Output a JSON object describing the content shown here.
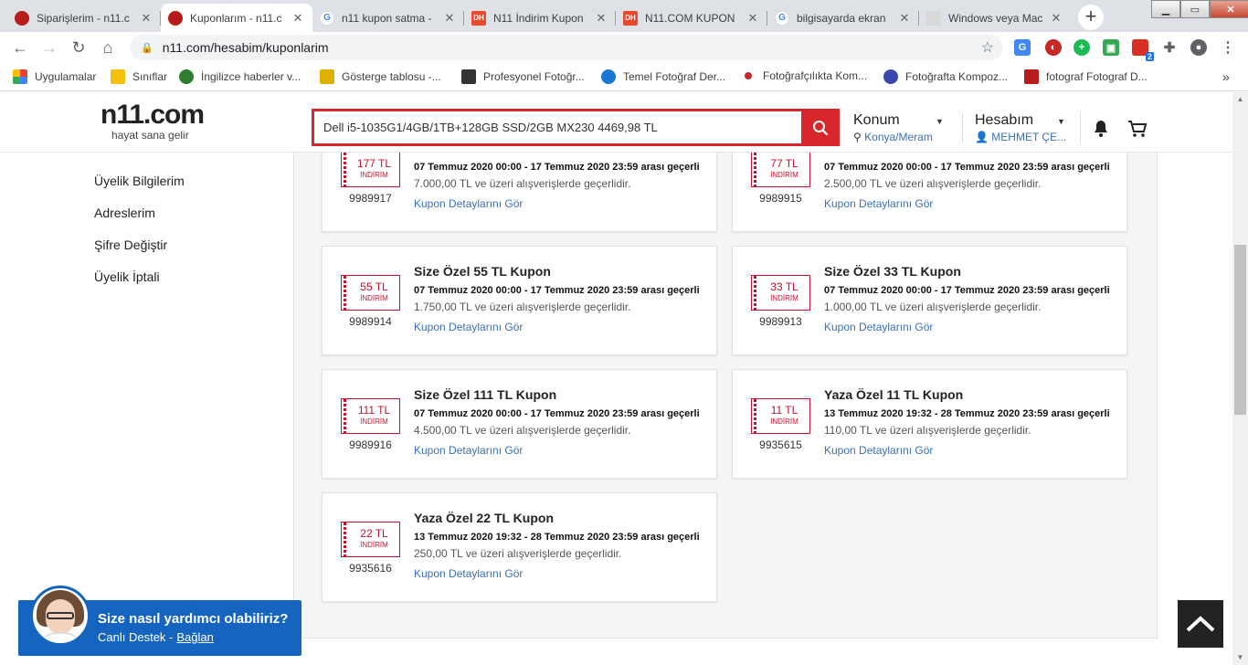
{
  "browser": {
    "tabs": [
      {
        "title": "Siparişlerim - n11.c",
        "icon": "ladybug-icon"
      },
      {
        "title": "Kuponlarım - n11.c",
        "icon": "ladybug-icon"
      },
      {
        "title": "n11 kupon satma -",
        "icon": "google-icon"
      },
      {
        "title": "N11 İndirim Kupon",
        "icon": "dh-icon"
      },
      {
        "title": "N11.COM KUPON",
        "icon": "dh-icon"
      },
      {
        "title": "bilgisayarda ekran",
        "icon": "google-icon"
      },
      {
        "title": "Windows veya Mac",
        "icon": "windows-icon"
      }
    ],
    "active_tab": 1,
    "url": "n11.com/hesabim/kuponlarim",
    "extension_badge": "2",
    "bookmarks": [
      "Uygulamalar",
      "Sınıflar",
      "İngilizce haberler v...",
      "Gösterge tablosu -...",
      "Profesyonel Fotoğr...",
      "Temel Fotoğraf Der...",
      "Fotoğrafçılıkta Kom...",
      "Fotoğrafta Kompoz...",
      "fotograf Fotograf D..."
    ],
    "bookmarks_overflow": "»"
  },
  "site": {
    "logo_text": "n11.com",
    "slogan": "hayat sana gelir",
    "search_value": "Dell i5-1035G1/4GB/1TB+128GB SSD/2GB MX230 4469,98 TL",
    "location_title": "Konum",
    "location_value": "Konya/Meram",
    "account_title": "Hesabım",
    "account_user": "MEHMET ÇE..."
  },
  "sidebar": {
    "items": [
      "Üyelik Bilgilerim",
      "Adreslerim",
      "Şifre Değiştir",
      "Üyelik İptali"
    ]
  },
  "coupons": [
    {
      "amount": "177 TL",
      "label": "İNDİRİM",
      "code": "9989917",
      "title": "",
      "date": "07 Temmuz 2020 00:00 - 17 Temmuz 2020 23:59 arası geçerli",
      "min": "7.000,00 TL ve üzeri alışverişlerde geçerlidir.",
      "link": "Kupon Detaylarını Gör"
    },
    {
      "amount": "77 TL",
      "label": "İNDİRİM",
      "code": "9989915",
      "title": "",
      "date": "07 Temmuz 2020 00:00 - 17 Temmuz 2020 23:59 arası geçerli",
      "min": "2.500,00 TL ve üzeri alışverişlerde geçerlidir.",
      "link": "Kupon Detaylarını Gör"
    },
    {
      "amount": "55 TL",
      "label": "İNDİRİM",
      "code": "9989914",
      "title": "Size Özel 55 TL Kupon",
      "date": "07 Temmuz 2020 00:00 - 17 Temmuz 2020 23:59 arası geçerli",
      "min": "1.750,00 TL ve üzeri alışverişlerde geçerlidir.",
      "link": "Kupon Detaylarını Gör"
    },
    {
      "amount": "33 TL",
      "label": "İNDİRİM",
      "code": "9989913",
      "title": "Size Özel 33 TL Kupon",
      "date": "07 Temmuz 2020 00:00 - 17 Temmuz 2020 23:59 arası geçerli",
      "min": "1.000,00 TL ve üzeri alışverişlerde geçerlidir.",
      "link": "Kupon Detaylarını Gör"
    },
    {
      "amount": "111 TL",
      "label": "İNDİRİM",
      "code": "9989916",
      "title": "Size Özel 111 TL Kupon",
      "date": "07 Temmuz 2020 00:00 - 17 Temmuz 2020 23:59 arası geçerli",
      "min": "4.500,00 TL ve üzeri alışverişlerde geçerlidir.",
      "link": "Kupon Detaylarını Gör"
    },
    {
      "amount": "11 TL",
      "label": "İNDİRİM",
      "code": "9935615",
      "title": "Yaza Özel 11 TL Kupon",
      "date": "13 Temmuz 2020 19:32 - 28 Temmuz 2020 23:59 arası geçerli",
      "min": "110,00 TL ve üzeri alışverişlerde geçerlidir.",
      "link": "Kupon Detaylarını Gör"
    },
    {
      "amount": "22 TL",
      "label": "İNDİRİM",
      "code": "9935616",
      "title": "Yaza Özel 22 TL Kupon",
      "date": "13 Temmuz 2020 19:32 - 28 Temmuz 2020 23:59 arası geçerli",
      "min": "250,00 TL ve üzeri alışverişlerde geçerlidir.",
      "link": "Kupon Detaylarını Gör"
    }
  ],
  "chat": {
    "question": "Size nasıl yardımcı olabiliriz?",
    "subtitle": "Canlı Destek -",
    "link": "Bağlan"
  },
  "colors": {
    "brand_red": "#d7262c",
    "link_blue": "#3b6fb6",
    "chat_blue": "#1565c0"
  }
}
